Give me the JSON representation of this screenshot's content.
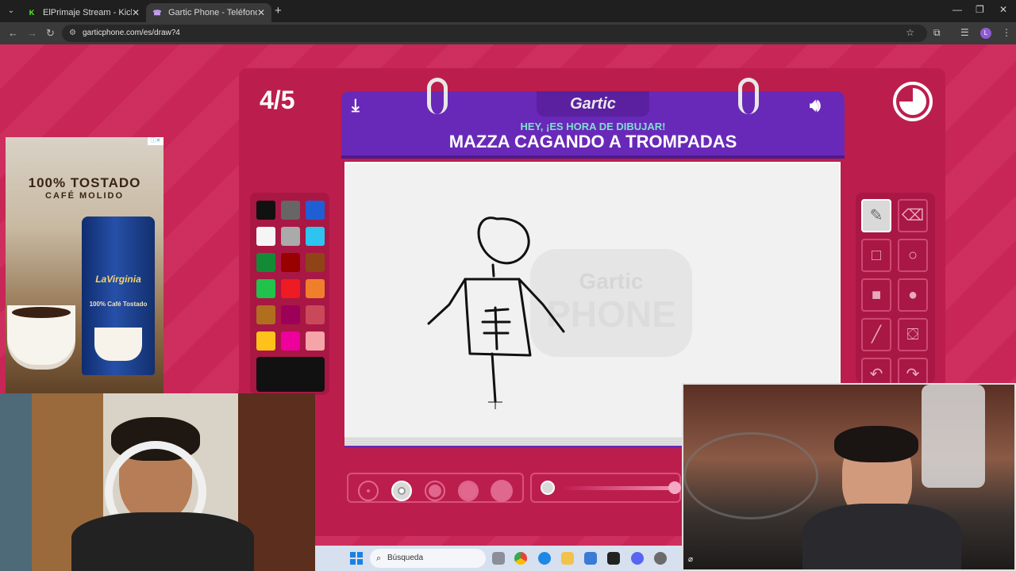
{
  "browser": {
    "tabs": [
      {
        "label": "ElPrimaje Stream - Kick Dashbo",
        "favicon": "K",
        "favicon_color": "#53fc18"
      },
      {
        "label": "Gartic Phone - Teléfono Descon",
        "favicon": "☎",
        "favicon_color": "#a855f7"
      }
    ],
    "url": "garticphone.com/es/draw?4"
  },
  "game": {
    "round": "4/5",
    "logo": "Gartic",
    "subtitle": "HEY, ¡ES HORA DE DIBUJAR!",
    "prompt": "MAZZA CAGANDO A TROMPADAS",
    "watermark": "Gartic PHONE",
    "palette": [
      "#111111",
      "#666666",
      "#1f5fd6",
      "#f5f5f5",
      "#aaaaaa",
      "#2ec4f0",
      "#138a36",
      "#990000",
      "#8e4416",
      "#21c24b",
      "#ee1b22",
      "#f07f2c",
      "#b06f1e",
      "#9d0059",
      "#c9495a",
      "#ffc21a",
      "#ee009c",
      "#f5a4a7"
    ],
    "current_color": "#111111",
    "tools": [
      "pencil-icon",
      "eraser-icon",
      "rectangle-outline-icon",
      "circle-outline-icon",
      "rectangle-fill-icon",
      "circle-fill-icon",
      "line-icon",
      "bucket-icon",
      "undo-icon",
      "redo-icon"
    ],
    "selected_tool": "pencil-icon",
    "brush_sizes": 5,
    "selected_brush": 2,
    "opacity": 1.0
  },
  "ad": {
    "headline": "100% TOSTADO",
    "subheadline": "CAFÉ MOLIDO",
    "brand": "LaVirginia",
    "product_line": "100% Café Tostado"
  },
  "taskbar": {
    "search_placeholder": "Búsqueda"
  }
}
